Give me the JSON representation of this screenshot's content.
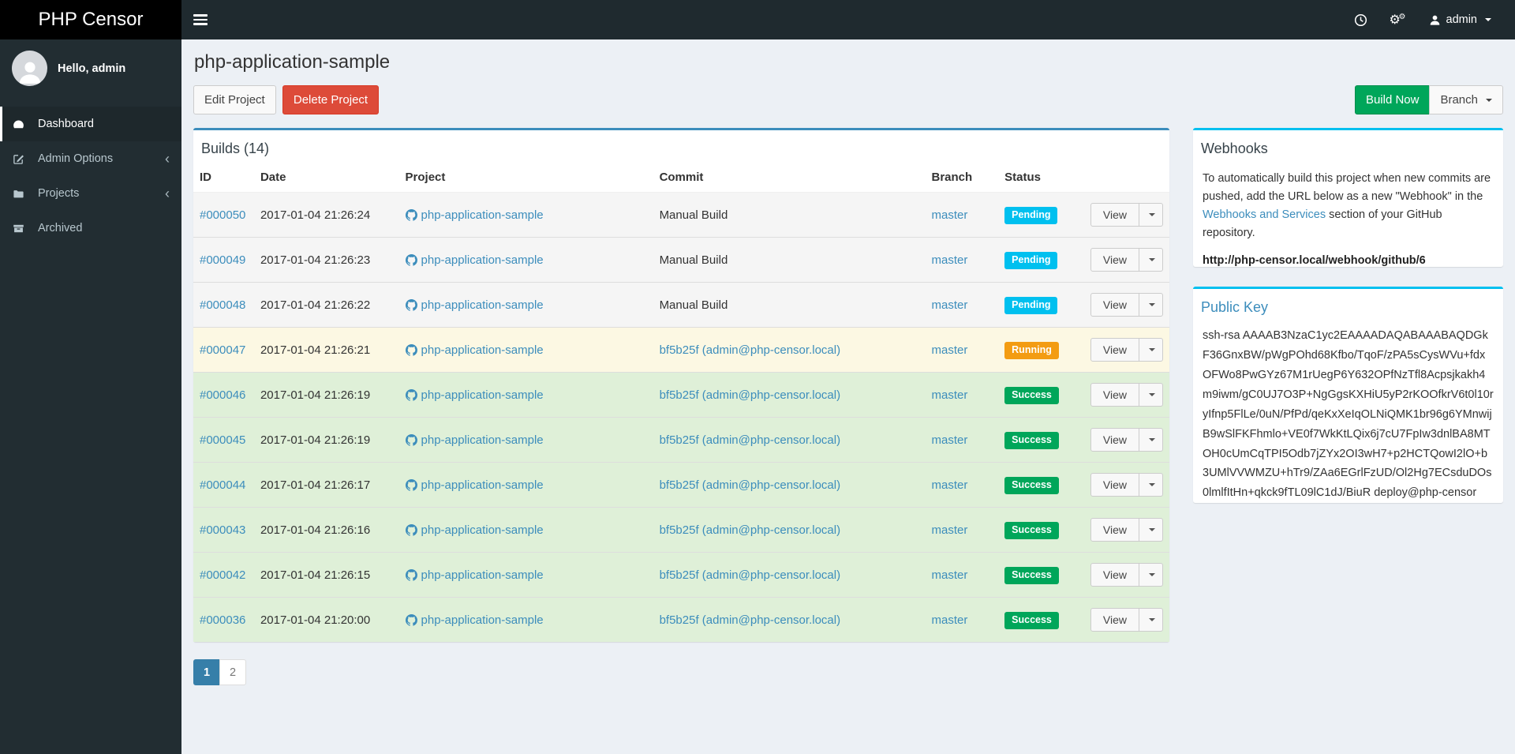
{
  "app": {
    "brand": "PHP Censor"
  },
  "navbar": {
    "user_label": "admin",
    "icons": [
      "clock-icon",
      "cogs-icon",
      "user-icon"
    ]
  },
  "sidebar": {
    "greeting": "Hello, admin",
    "items": [
      {
        "label": "Dashboard",
        "icon": "icon-dashboard",
        "active": true,
        "has_children": false
      },
      {
        "label": "Admin Options",
        "icon": "icon-edit",
        "active": false,
        "has_children": true
      },
      {
        "label": "Projects",
        "icon": "icon-folder",
        "active": false,
        "has_children": true
      },
      {
        "label": "Archived",
        "icon": "icon-archive",
        "active": false,
        "has_children": false
      }
    ],
    "collapse_glyph": "‹"
  },
  "page": {
    "title": "php-application-sample",
    "edit_button": "Edit Project",
    "delete_button": "Delete Project",
    "build_now_button": "Build Now",
    "branch_button": "Branch"
  },
  "builds_panel": {
    "title": "Builds (14)",
    "columns": [
      "ID",
      "Date",
      "Project",
      "Commit",
      "Branch",
      "Status",
      ""
    ],
    "view_button": "View",
    "builds": [
      {
        "id": "#000050",
        "date": "2017-01-04 21:26:24",
        "project": "php-application-sample",
        "commit": "Manual Build",
        "commit_is_link": false,
        "branch": "master",
        "status": "Pending",
        "state": "pending"
      },
      {
        "id": "#000049",
        "date": "2017-01-04 21:26:23",
        "project": "php-application-sample",
        "commit": "Manual Build",
        "commit_is_link": false,
        "branch": "master",
        "status": "Pending",
        "state": "pending"
      },
      {
        "id": "#000048",
        "date": "2017-01-04 21:26:22",
        "project": "php-application-sample",
        "commit": "Manual Build",
        "commit_is_link": false,
        "branch": "master",
        "status": "Pending",
        "state": "pending"
      },
      {
        "id": "#000047",
        "date": "2017-01-04 21:26:21",
        "project": "php-application-sample",
        "commit": "bf5b25f (admin@php-censor.local)",
        "commit_is_link": true,
        "branch": "master",
        "status": "Running",
        "state": "running"
      },
      {
        "id": "#000046",
        "date": "2017-01-04 21:26:19",
        "project": "php-application-sample",
        "commit": "bf5b25f (admin@php-censor.local)",
        "commit_is_link": true,
        "branch": "master",
        "status": "Success",
        "state": "success"
      },
      {
        "id": "#000045",
        "date": "2017-01-04 21:26:19",
        "project": "php-application-sample",
        "commit": "bf5b25f (admin@php-censor.local)",
        "commit_is_link": true,
        "branch": "master",
        "status": "Success",
        "state": "success"
      },
      {
        "id": "#000044",
        "date": "2017-01-04 21:26:17",
        "project": "php-application-sample",
        "commit": "bf5b25f (admin@php-censor.local)",
        "commit_is_link": true,
        "branch": "master",
        "status": "Success",
        "state": "success"
      },
      {
        "id": "#000043",
        "date": "2017-01-04 21:26:16",
        "project": "php-application-sample",
        "commit": "bf5b25f (admin@php-censor.local)",
        "commit_is_link": true,
        "branch": "master",
        "status": "Success",
        "state": "success"
      },
      {
        "id": "#000042",
        "date": "2017-01-04 21:26:15",
        "project": "php-application-sample",
        "commit": "bf5b25f (admin@php-censor.local)",
        "commit_is_link": true,
        "branch": "master",
        "status": "Success",
        "state": "success"
      },
      {
        "id": "#000036",
        "date": "2017-01-04 21:20:00",
        "project": "php-application-sample",
        "commit": "bf5b25f (admin@php-censor.local)",
        "commit_is_link": true,
        "branch": "master",
        "status": "Success",
        "state": "success"
      }
    ]
  },
  "pagination": {
    "pages": [
      "1",
      "2"
    ],
    "active": "1"
  },
  "webhooks_panel": {
    "title": "Webhooks",
    "text_before": "To automatically build this project when new commits are pushed, add the URL below as a new \"Webhook\" in the ",
    "link_text": "Webhooks and Services",
    "text_after": " section of your GitHub repository.",
    "url": "http://php-censor.local/webhook/github/6"
  },
  "public_key_panel": {
    "title": "Public Key",
    "key": "ssh-rsa AAAAB3NzaC1yc2EAAAADAQABAAABAQDGkF36GnxBW/pWgPOhd68Kfbo/TqoF/zPA5sCysWVu+fdxOFWo8PwGYz67M1rUegP6Y632OPfNzTfl8Acpsjkakh4m9iwm/gC0UJ7O3P+NgGgsKXHiU5yP2rKOOfkrV6t0l10ryIfnp5FlLe/0uN/PfPd/qeKxXeIqOLNiQMK1br96g6YMnwijB9wSlFKFhmlo+VE0f7WkKtLQix6j7cU7FpIw3dnlBA8MTOH0cUmCqTPI5Odb7jZYx2OI3wH7+p2HCTQowI2lO+b3UMlVVWMZU+hTr9/ZAa6EGrlFzUD/Ol2Hg7ECsduDOs0lmlfItHn+qkck9fTL09lC1dJ/BiuR deploy@php-censor"
  },
  "colors": {
    "accent": "#3c8dbc",
    "status": {
      "pending": "#00c0ef",
      "running": "#f39c12",
      "success": "#00a65a"
    },
    "rows": {
      "pending": "#f5f5f5",
      "running": "#fcf8e3",
      "success": "#dff0d8"
    },
    "danger": "#dd4b39",
    "build_now": "#00a65a"
  }
}
